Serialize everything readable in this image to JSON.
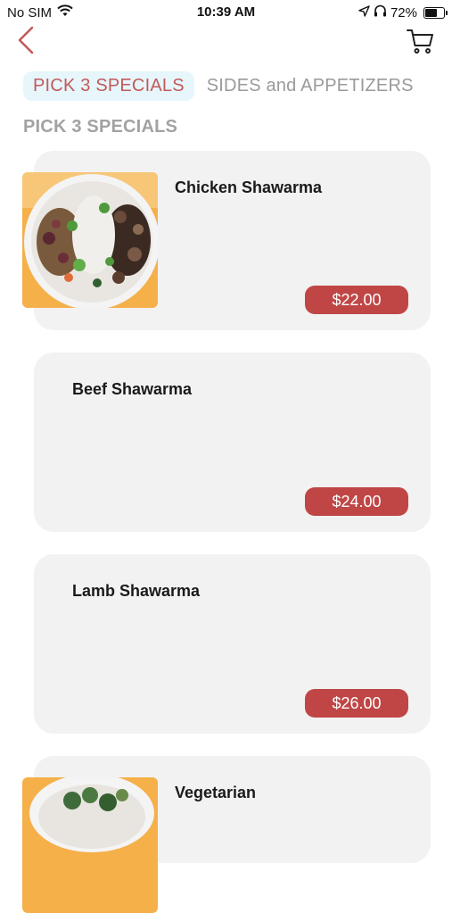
{
  "status_bar": {
    "carrier": "No SIM",
    "time": "10:39 AM",
    "battery_percent": "72%",
    "battery_level": 0.72
  },
  "header": {
    "back_icon": "chevron-left-icon",
    "cart_icon": "cart-icon"
  },
  "tabs": [
    {
      "label": "PICK 3 SPECIALS",
      "active": true
    },
    {
      "label": "SIDES and APPETIZERS",
      "active": false
    }
  ],
  "section_title": "PICK 3 SPECIALS",
  "items": [
    {
      "name": "Chicken Shawarma",
      "price": "$22.00",
      "has_image": true
    },
    {
      "name": "Beef Shawarma",
      "price": "$24.00",
      "has_image": false
    },
    {
      "name": "Lamb Shawarma",
      "price": "$26.00",
      "has_image": false
    },
    {
      "name": "Vegetarian",
      "has_image": true
    }
  ],
  "colors": {
    "accent": "#c04646",
    "active_tab_bg": "#e6f6fb",
    "active_tab_text": "#c35a5a",
    "card_bg": "#f2f2f2",
    "muted_text": "#9a9a9a"
  }
}
